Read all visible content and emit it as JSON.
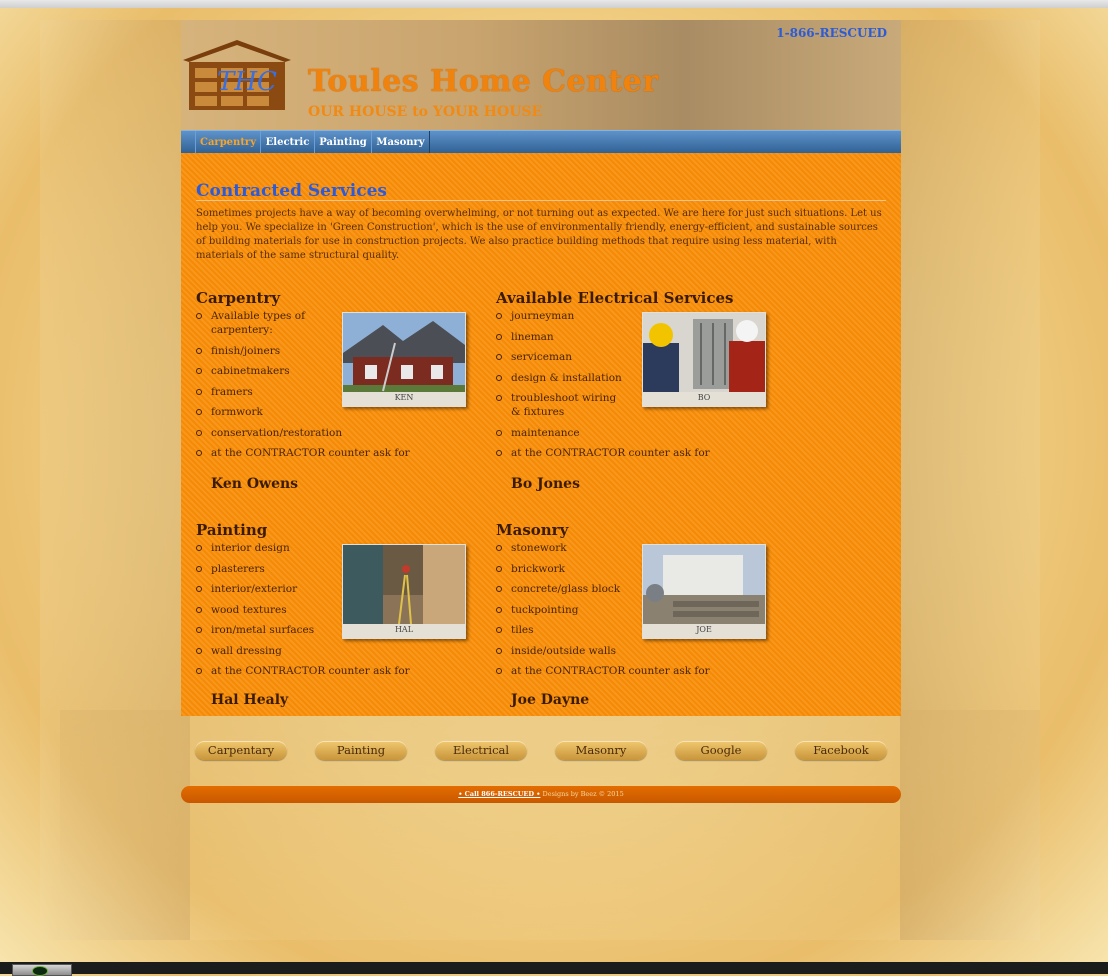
{
  "header": {
    "title": "Toules Home Center",
    "tagline": "OUR HOUSE to YOUR HOUSE",
    "phone": "1-866-RESCUED",
    "logo_text": "THC"
  },
  "nav": [
    {
      "label": "Carpentry",
      "active": true
    },
    {
      "label": "Electric",
      "active": false
    },
    {
      "label": "Painting",
      "active": false
    },
    {
      "label": "Masonry",
      "active": false
    }
  ],
  "main": {
    "heading": "Contracted Services",
    "intro": "Sometimes projects have a way of becoming overwhelming, or not turning out as expected. We are here for just such situations. Let us help you. We specialize in 'Green Construction', which is the use of environmentally friendly, energy-efficient, and sustainable sources of building materials for use in construction projects. We also practice building methods that require using less material, with materials of the same structural quality."
  },
  "sections": {
    "carpentry": {
      "title": "Carpentry",
      "items": [
        "Available types of carpentery:",
        "finish/joiners",
        "cabinetmakers",
        "framers",
        "formwork",
        "conservation/restoration",
        "at the CONTRACTOR counter ask for"
      ],
      "contact": "Ken Owens",
      "photo_caption": "KEN"
    },
    "electrical": {
      "title": "Available Electrical Services",
      "items": [
        "journeyman",
        "lineman",
        "serviceman",
        "design & installation",
        "troubleshoot wiring & fixtures",
        "maintenance",
        "at the CONTRACTOR counter ask for"
      ],
      "contact": "Bo Jones",
      "photo_caption": "BO"
    },
    "painting": {
      "title": "Painting",
      "items": [
        "interior design",
        "plasterers",
        "interior/exterior",
        "wood textures",
        "iron/metal surfaces",
        "wall dressing",
        "at the CONTRACTOR counter ask for"
      ],
      "contact": "Hal Healy",
      "photo_caption": "HAL"
    },
    "masonry": {
      "title": "Masonry",
      "items": [
        "stonework",
        "brickwork",
        "concrete/glass block",
        "tuckpointing",
        "tiles",
        "inside/outside walls",
        "at the CONTRACTOR counter ask for"
      ],
      "contact": "Joe Dayne",
      "photo_caption": "JOE"
    }
  },
  "buttons": [
    "Carpentary",
    "Painting",
    "Electrical",
    "Masonry",
    "Google",
    "Facebook"
  ],
  "footer": {
    "link": "• Call 866-RESCUED •",
    "credit": "Designs by Beez © 2015"
  },
  "colors": {
    "accent_orange": "#f48a06",
    "title_orange": "#f0830d",
    "heading_blue": "#2d5bd8",
    "nav_blue": "#2f5f93"
  }
}
